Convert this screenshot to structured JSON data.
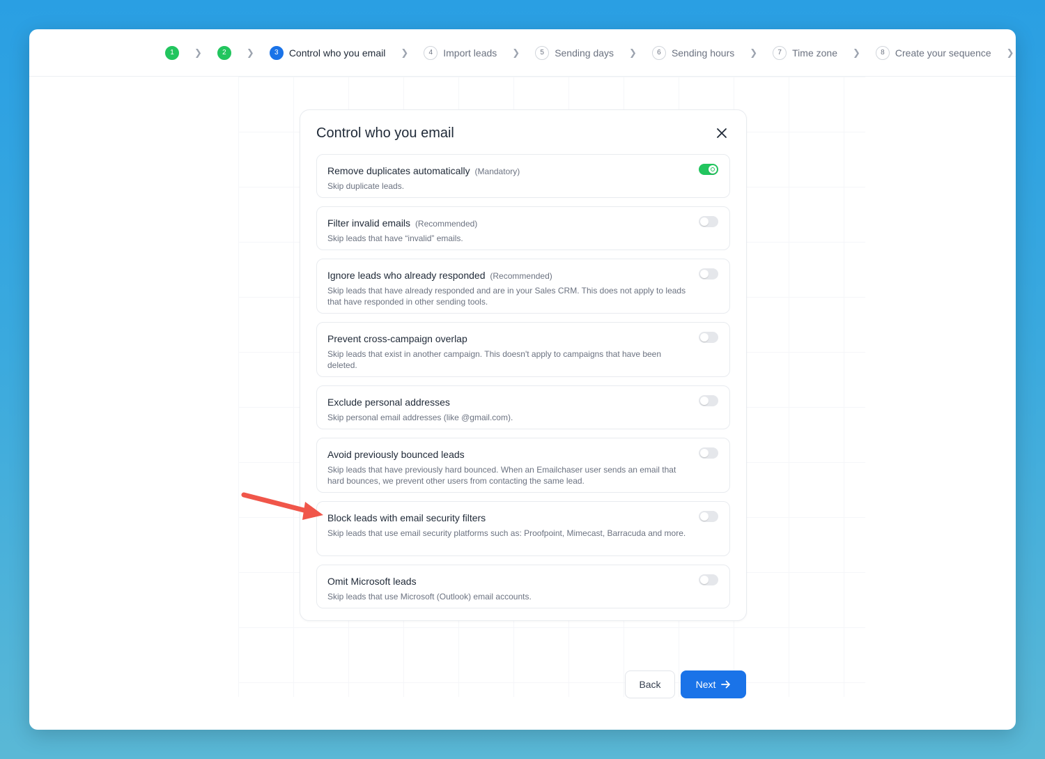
{
  "stepper": {
    "steps": [
      {
        "num": "1",
        "label": ""
      },
      {
        "num": "2",
        "label": ""
      },
      {
        "num": "3",
        "label": "Control who you email"
      },
      {
        "num": "4",
        "label": "Import leads"
      },
      {
        "num": "5",
        "label": "Sending days"
      },
      {
        "num": "6",
        "label": "Sending hours"
      },
      {
        "num": "7",
        "label": "Time zone"
      },
      {
        "num": "8",
        "label": "Create your sequence"
      }
    ]
  },
  "modal": {
    "title": "Control who you email",
    "options": [
      {
        "title": "Remove duplicates automatically",
        "tag": "(Mandatory)",
        "desc": "Skip duplicate leads.",
        "enabled": true
      },
      {
        "title": "Filter invalid emails",
        "tag": "(Recommended)",
        "desc": "Skip leads that have “invalid” emails.",
        "enabled": false
      },
      {
        "title": "Ignore leads who already responded",
        "tag": "(Recommended)",
        "desc": "Skip leads that have already responded and are in your Sales CRM. This does not apply to leads that have responded in other sending tools.",
        "enabled": false
      },
      {
        "title": "Prevent cross-campaign overlap",
        "tag": "",
        "desc": "Skip leads that exist in another campaign. This doesn't apply to campaigns that have been deleted.",
        "enabled": false
      },
      {
        "title": "Exclude personal addresses",
        "tag": "",
        "desc": "Skip personal email addresses (like @gmail.com).",
        "enabled": false
      },
      {
        "title": "Avoid previously bounced leads",
        "tag": "",
        "desc": "Skip leads that have previously hard bounced. When an Emailchaser user sends an email that hard bounces, we prevent other users from contacting the same lead.",
        "enabled": false
      },
      {
        "title": "Block leads with email security filters",
        "tag": "",
        "desc": "Skip leads that use email security platforms such as: Proofpoint, Mimecast, Barracuda and more.",
        "enabled": false
      },
      {
        "title": "Omit Microsoft leads",
        "tag": "",
        "desc": "Skip leads that use Microsoft (Outlook) email accounts.",
        "enabled": false
      }
    ]
  },
  "footer": {
    "back_label": "Back",
    "next_label": "Next"
  },
  "colors": {
    "primary": "#1a73e8",
    "success": "#22c55e",
    "annotation_arrow": "#f0564a"
  }
}
